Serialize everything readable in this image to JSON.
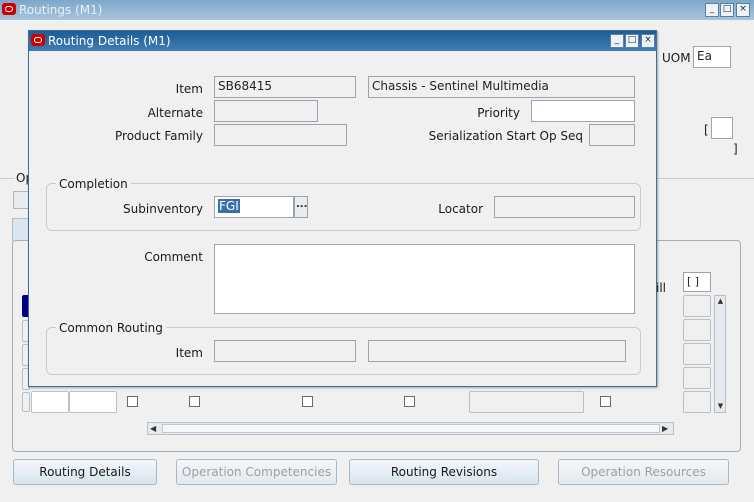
{
  "main_window": {
    "title": "Routings (M1)",
    "uom_label": "UOM",
    "uom_value": "Ea",
    "bracket_open": "[",
    "bracket_close": "]",
    "tab_fragment": "Op",
    "bill_fragment": "ill",
    "row_bracket": "[ ]"
  },
  "dialog": {
    "title": "Routing Details (M1)",
    "item_label": "Item",
    "item_value": "SB68415",
    "item_description": "Chassis - Sentinel Multimedia",
    "alternate_label": "Alternate",
    "alternate_value": "",
    "priority_label": "Priority",
    "priority_value": "",
    "product_family_label": "Product Family",
    "product_family_value": "",
    "serialization_label": "Serialization Start Op Seq",
    "serialization_value": "",
    "completion": {
      "title": "Completion",
      "subinventory_label": "Subinventory",
      "subinventory_value": "FGI",
      "lov_button": "...",
      "locator_label": "Locator",
      "locator_value": ""
    },
    "comment_label": "Comment",
    "comment_value": "",
    "common_routing": {
      "title": "Common Routing",
      "item_label": "Item",
      "item_value": "",
      "item_description": ""
    }
  },
  "buttons": {
    "routing_details": "Routing Details",
    "operation_competencies": "Operation Competencies",
    "routing_revisions": "Routing Revisions",
    "operation_resources": "Operation Resources"
  },
  "colors": {
    "active_titlebar": "#1c5d95",
    "inactive_titlebar": "#a9c4dc",
    "disabled_text": "#9aa0a6",
    "selected_row": "#000080"
  }
}
